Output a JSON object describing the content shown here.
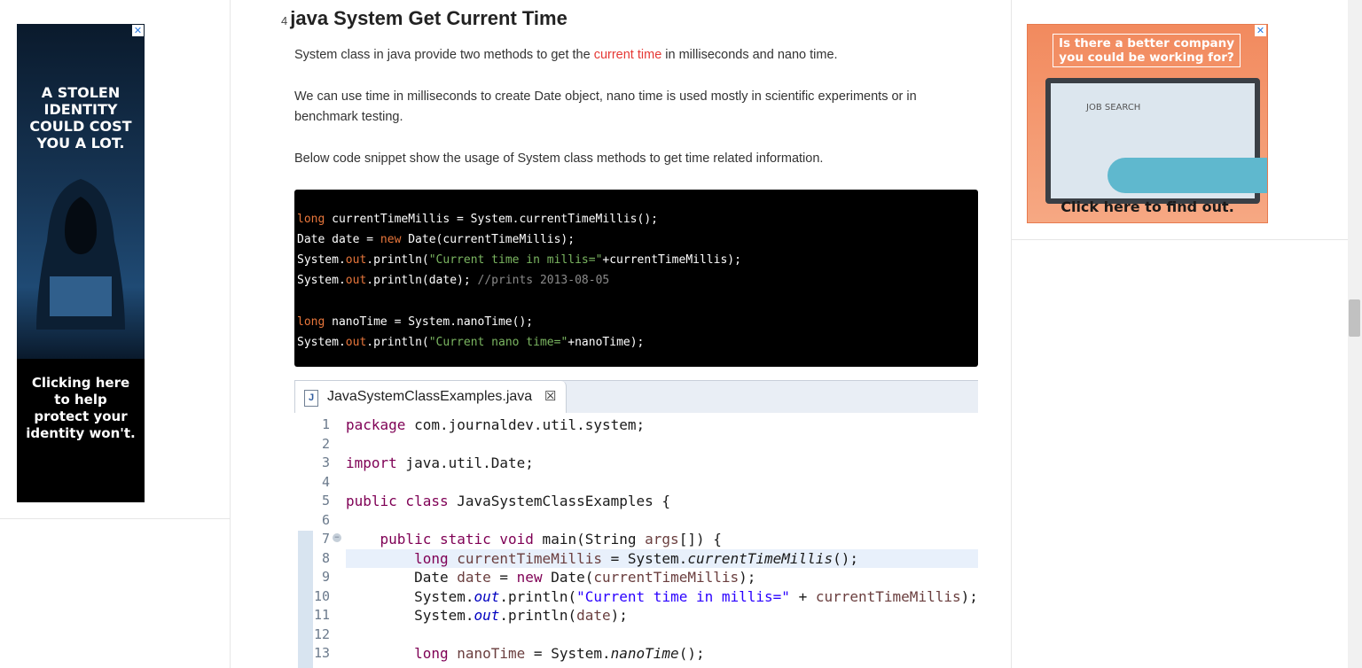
{
  "left_ad": {
    "headline": "A STOLEN\nIDENTITY\nCOULD COST\nYOU A LOT.",
    "subtext": "Clicking here\nto help\nprotect your\nidentity won't.",
    "close_glyph": "✕"
  },
  "right_ad": {
    "question": "Is there a better company\nyou could be working for?",
    "screen_label": "JOB SEARCH",
    "cta": "Click here to find out.",
    "close_glyph": "✕"
  },
  "article": {
    "section_number": "4",
    "heading": "java System Get Current Time",
    "p1_before": "System class in java provide two methods to get the ",
    "p1_link": "current time",
    "p1_after": " in milliseconds and nano time.",
    "p2": "We can use time in milliseconds to create Date object, nano time is used mostly in scientific experiments or in benchmark testing.",
    "p3": "Below code snippet show the usage of System class methods to get time related information."
  },
  "code_snippet": {
    "l1_kw": "long",
    "l1_rest": " currentTimeMillis = System.currentTimeMillis();",
    "l2_a": "Date date = ",
    "l2_kw": "new",
    "l2_b": " Date(currentTimeMillis);",
    "l3_a": "System.",
    "l3_kw": "out",
    "l3_b": ".println(",
    "l3_str": "\"Current time in millis=\"",
    "l3_c": "+currentTimeMillis);",
    "l4_a": "System.",
    "l4_kw": "out",
    "l4_b": ".println(date); ",
    "l4_cmt": "//prints 2013-08-05",
    "l6_kw": "long",
    "l6_rest": " nanoTime = System.nanoTime();",
    "l7_a": "System.",
    "l7_kw": "out",
    "l7_b": ".println(",
    "l7_str": "\"Current nano time=\"",
    "l7_c": "+nanoTime);"
  },
  "eclipse": {
    "tab_filename": "JavaSystemClassExamples.java",
    "tab_icon": "J",
    "close_icon": "☒",
    "lines": [
      {
        "n": "1"
      },
      {
        "n": "2"
      },
      {
        "n": "3"
      },
      {
        "n": "4"
      },
      {
        "n": "5"
      },
      {
        "n": "6"
      },
      {
        "n": "7"
      },
      {
        "n": "8"
      },
      {
        "n": "9"
      },
      {
        "n": "10"
      },
      {
        "n": "11"
      },
      {
        "n": "12"
      },
      {
        "n": "13"
      }
    ],
    "t1_kw": "package",
    "t1_rest": " com.journaldev.util.system;",
    "t3_kw": "import",
    "t3_rest": " java.util.Date;",
    "t5_kw": "public class",
    "t5_rest": " JavaSystemClassExamples {",
    "t7_kw": "public static void",
    "t7_a": " main(String ",
    "t7_var": "args",
    "t7_b": "[]) {",
    "t8_kw": "long",
    "t8_var": " currentTimeMillis",
    "t8_a": " = System.",
    "t8_m": "currentTimeMillis",
    "t8_b": "();",
    "t9_a": "Date ",
    "t9_var": "date",
    "t9_b": " = ",
    "t9_kw": "new",
    "t9_c": " Date(",
    "t9_var2": "currentTimeMillis",
    "t9_d": ");",
    "t10_a": "System.",
    "t10_f": "out",
    "t10_b": ".println(",
    "t10_s": "\"Current time in millis=\"",
    "t10_c": " + ",
    "t10_var": "currentTimeMillis",
    "t10_d": ");",
    "t11_a": "System.",
    "t11_f": "out",
    "t11_b": ".println(",
    "t11_var": "date",
    "t11_c": ");",
    "t13_kw": "long",
    "t13_var": " nanoTime",
    "t13_a": " = System.",
    "t13_m": "nanoTime",
    "t13_b": "();"
  }
}
